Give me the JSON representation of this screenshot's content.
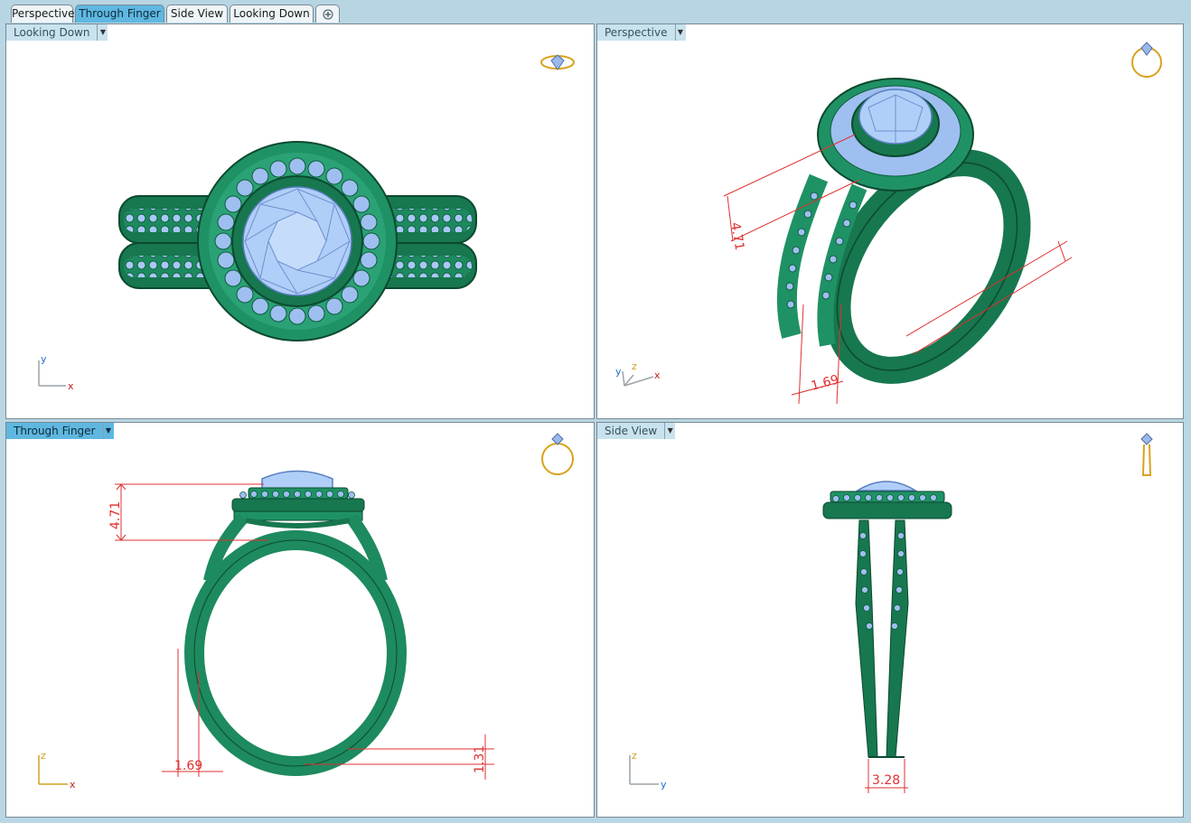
{
  "tabs": [
    {
      "label": "Perspective",
      "active": false
    },
    {
      "label": "Through Finger",
      "active": true
    },
    {
      "label": "Side View",
      "active": false
    },
    {
      "label": "Looking Down",
      "active": false
    }
  ],
  "add_tab_icon": "plus-icon",
  "viewports": {
    "top_left": {
      "label": "Looking Down",
      "axis_a": "y",
      "axis_b": "x"
    },
    "top_right": {
      "label": "Perspective",
      "axis_a": "y",
      "axis_b": "z",
      "axis_c": "x",
      "dim_1": "4.71",
      "dim_2": "1.69"
    },
    "bottom_left": {
      "label": "Through Finger",
      "axis_a": "z",
      "axis_b": "x",
      "dim_1": "4.71",
      "dim_2": "1.69",
      "dim_3": "1.31"
    },
    "bottom_right": {
      "label": "Side View",
      "axis_a": "z",
      "axis_b": "y",
      "dim_1": "3.28"
    }
  },
  "colors": {
    "ring_metal": "#1c8a5e",
    "gem": "#a8c8f6",
    "dimension": "#e03030",
    "accent": "#5fb7e0"
  }
}
